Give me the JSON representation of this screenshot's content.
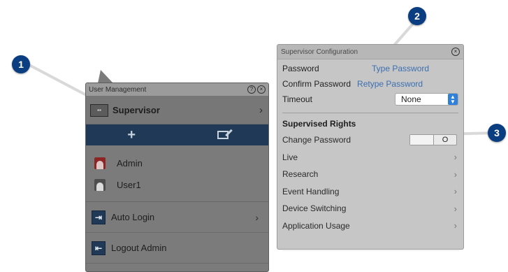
{
  "callouts": [
    {
      "label": "1"
    },
    {
      "label": "2"
    },
    {
      "label": "3"
    }
  ],
  "user_management": {
    "title": "User Management",
    "help_icon": "?",
    "close_icon": "⊗",
    "role": {
      "name": "Supervisor",
      "icon": "id-card-icon"
    },
    "toolbar": {
      "add": "+",
      "edit_icon": "edit-icon"
    },
    "users": [
      {
        "name": "Admin",
        "icon": "admin-avatar-icon"
      },
      {
        "name": "User1",
        "icon": "user-avatar-icon"
      }
    ],
    "options": [
      {
        "label": "Auto Login",
        "icon": "login-icon",
        "chevron": "›"
      },
      {
        "label": "Logout Admin",
        "icon": "logout-icon"
      }
    ],
    "colors": {
      "panel": "#7b7b7b",
      "toolbar": "#1f3957"
    }
  },
  "supervisor_config": {
    "title": "Supervisor Configuration",
    "close_icon": "⊗",
    "password": {
      "label": "Password",
      "placeholder": "Type Password"
    },
    "confirm_password": {
      "label": "Confirm Password",
      "placeholder": "Retype Password"
    },
    "timeout": {
      "label": "Timeout",
      "value": "None"
    },
    "section_title": "Supervised Rights",
    "change_password": {
      "label": "Change Password",
      "toggle_value": "O"
    },
    "rights": [
      {
        "label": "Live"
      },
      {
        "label": "Research"
      },
      {
        "label": "Event Handling"
      },
      {
        "label": "Device Switching"
      },
      {
        "label": "Application Usage"
      }
    ],
    "colors": {
      "panel": "#c6c6c6",
      "link": "#3b6fb0",
      "select_arrow": "#2f80d8"
    }
  },
  "colors": {
    "badge": "#0a3e80"
  }
}
